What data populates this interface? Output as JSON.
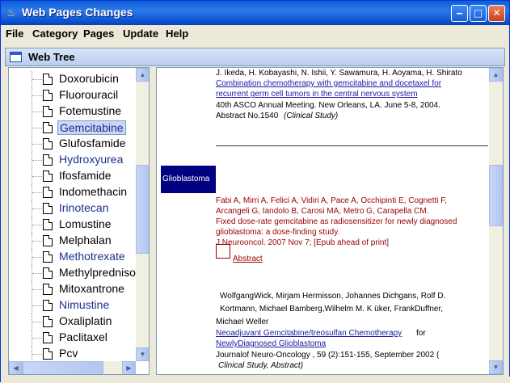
{
  "window": {
    "title": "Web Pages Changes",
    "minimize_symbol": "‒",
    "maximize_symbol": "□",
    "close_symbol": "✕"
  },
  "menu": {
    "items": [
      "File",
      "Category",
      "Pages",
      "Update",
      "Help"
    ]
  },
  "panel": {
    "title": "Web Tree"
  },
  "tree": {
    "items": [
      {
        "label": "Doxorubicin",
        "state": "normal"
      },
      {
        "label": "Fluorouracil",
        "state": "normal"
      },
      {
        "label": "Fotemustine",
        "state": "normal"
      },
      {
        "label": "Gemcitabine",
        "state": "selected"
      },
      {
        "label": "Glufosfamide",
        "state": "normal"
      },
      {
        "label": "Hydroxyurea",
        "state": "blue"
      },
      {
        "label": "Ifosfamide",
        "state": "normal"
      },
      {
        "label": "Indomethacin",
        "state": "normal"
      },
      {
        "label": "Irinotecan",
        "state": "blue"
      },
      {
        "label": "Lomustine",
        "state": "normal"
      },
      {
        "label": "Melphalan",
        "state": "normal"
      },
      {
        "label": "Methotrexate",
        "state": "blue"
      },
      {
        "label": "Methylpredniso",
        "state": "normal"
      },
      {
        "label": "Mitoxantrone",
        "state": "normal"
      },
      {
        "label": "Nimustine",
        "state": "blue"
      },
      {
        "label": "Oxaliplatin",
        "state": "normal"
      },
      {
        "label": "Paclitaxel",
        "state": "normal"
      },
      {
        "label": "Pcv",
        "state": "normal"
      }
    ]
  },
  "content": {
    "entry1": {
      "authors": "J. Ikeda, H. Kobayashi, N. Ishii, Y. Sawamura, H. Aoyama, H. Shirato",
      "title_line1": "Combination chemotherapy with gemcitabine and docetaxel for",
      "title_line2": "recurrent germ cell tumors in the central nervous system",
      "meeting": "40th ASCO Annual Meeting. New Orleans, LA. June 5-8, 2004.",
      "abstract_no": "Abstract No.1540",
      "study_type": "(Clinical Study)"
    },
    "category_label": "Glioblastoma",
    "entry2": {
      "authors_line1": "Fabi A, Mirri A, Felici A, Vidiri A, Pace A, Occhipinti E, Cognetti F,",
      "authors_line2": "Arcangeli G, Iandolo B, Carosi MA, Metro G, Carapella CM.",
      "title_line1": "Fixed dose-rate gemcitabine as radiosensitizer for newly diagnosed",
      "title_line2": "glioblastoma: a dose-finding study.",
      "journal": "J Neurooncol. 2007 Nov 7; [Epub ahead of print]",
      "abstract_link": "Abstract"
    },
    "entry3": {
      "authors_line1": "WolfgangWick, Mirjam Hermisson, Johannes Dichgans, Rolf D.",
      "authors_line2": "Kortmann, Michael Bamberg,Wilhelm M. K  üker,   FrankDuffner,",
      "authors_line3": "Michael Weller",
      "title_line1": "Neoadjuvant Gemcitabine/treosulfan Chemotherapy",
      "title_line1_suffix": "for",
      "title_line2": "NewlyDiagnosed Glioblastoma",
      "journal": "Journalof Neuro-Oncology  ,  59 (2):151-155, September 2002 (",
      "study_type": "Clinical  Study,   Abstract)"
    }
  }
}
